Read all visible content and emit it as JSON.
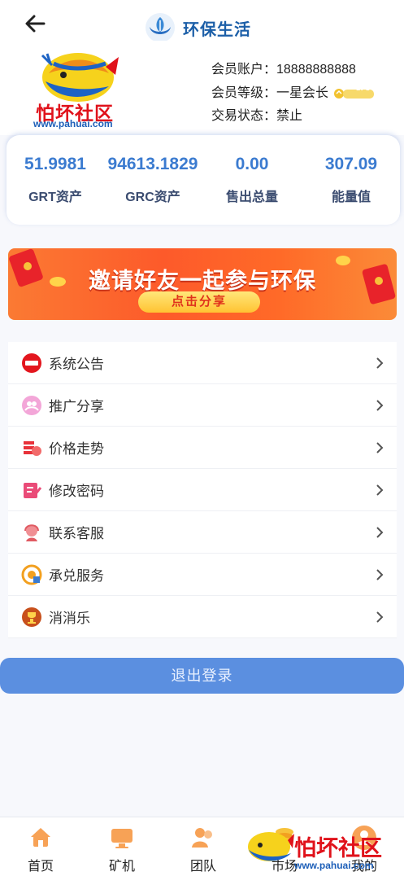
{
  "header": {
    "back_icon": "arrow-left-icon",
    "title": "环保生活",
    "logo_icon": "hands-leaf-logo-icon"
  },
  "profile": {
    "brand_name": "怕坏社区",
    "brand_url": "www.pahuai.com",
    "account_line": "会员账户：18888888888",
    "level_line": "会员等级：一星会长",
    "level_badge": "LV 1",
    "trade_line": "交易状态：禁止"
  },
  "stats": [
    {
      "value": "51.9981",
      "label": "GRT资产"
    },
    {
      "value": "94613.1829",
      "label": "GRC资产"
    },
    {
      "value": "0.00",
      "label": "售出总量"
    },
    {
      "value": "307.09",
      "label": "能量值"
    }
  ],
  "banner": {
    "title": "邀请好友一起参与环保",
    "button": "点击分享"
  },
  "menu": [
    {
      "label": "系统公告",
      "icon": "announcement-icon"
    },
    {
      "label": "推广分享",
      "icon": "share-people-icon"
    },
    {
      "label": "价格走势",
      "icon": "price-trend-icon"
    },
    {
      "label": "修改密码",
      "icon": "edit-password-icon"
    },
    {
      "label": "联系客服",
      "icon": "customer-service-icon"
    },
    {
      "label": "承兑服务",
      "icon": "exchange-service-icon"
    },
    {
      "label": "消消乐",
      "icon": "trophy-icon"
    }
  ],
  "logout": "退出登录",
  "tabs": [
    {
      "label": "首页",
      "icon": "home-icon"
    },
    {
      "label": "矿机",
      "icon": "monitor-icon"
    },
    {
      "label": "团队",
      "icon": "team-icon"
    },
    {
      "label": "市场",
      "icon": "coins-icon"
    },
    {
      "label": "我的",
      "icon": "user-icon"
    }
  ],
  "watermark": {
    "text": "怕坏社区",
    "url": "www.pahuai.com"
  },
  "colors": {
    "primary": "#3b7bd0",
    "logout_bg": "#5b8fe0",
    "banner_orange": "#fd5a2a",
    "brand_red": "#e0121b"
  }
}
